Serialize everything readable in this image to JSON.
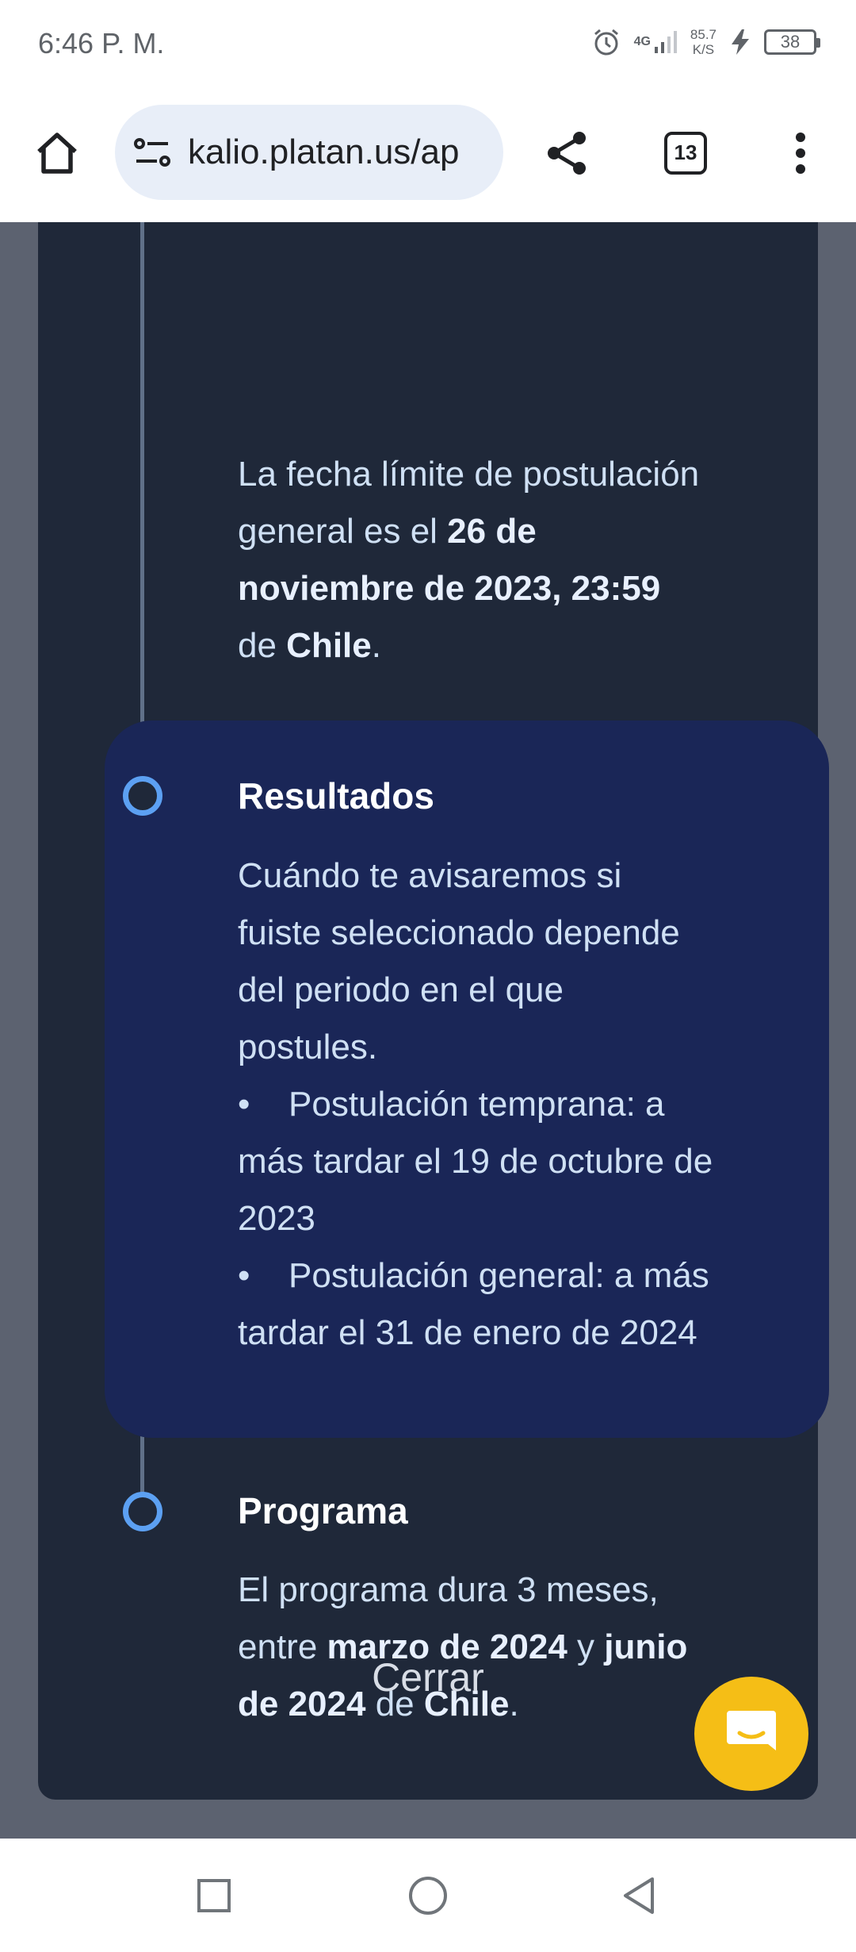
{
  "status_bar": {
    "time": "6:46 P. M.",
    "network_type": "4G",
    "network_speed_value": "85.7",
    "network_speed_unit": "K/S",
    "battery_level": "38",
    "icons": [
      "alarm-icon",
      "signal-icon",
      "charging-icon",
      "battery-icon"
    ]
  },
  "browser": {
    "url": "kalio.platan.us/ap",
    "tab_count": "13",
    "icons": [
      "home-icon",
      "site-info-icon",
      "share-icon",
      "tab-switcher-icon",
      "more-vert-icon"
    ]
  },
  "timeline": {
    "deadline_text": {
      "line1": "La fecha límite de postulación",
      "line2_pre": "general es el ",
      "line2_bold": "26 de",
      "line3_bold": "noviembre de 2023, 23:59",
      "line4_pre": "de ",
      "line4_bold": "Chile",
      "line4_post": "."
    },
    "results": {
      "title": "Resultados",
      "body": [
        "Cuándo te avisaremos si",
        "fuiste seleccionado depende",
        "del periodo en el que",
        "postules."
      ],
      "bullet": "•",
      "early": [
        "Postulación temprana: a",
        "más tardar el 19 de octubre de",
        "2023"
      ],
      "general": [
        "Postulación general: a más",
        "tardar el 31 de enero de 2024"
      ]
    },
    "program": {
      "title": "Programa",
      "line1": "El programa dura 3 meses,",
      "line2_pre": "entre ",
      "line2_bold1": "marzo de 2024",
      "line2_mid": " y ",
      "line2_bold2": "junio",
      "line3_bold1": "de 2024",
      "line3_mid": " de ",
      "line3_bold2": "Chile",
      "line3_post": "."
    }
  },
  "modal": {
    "close_label": "Cerrar"
  },
  "colors": {
    "accent": "#5ca0f2",
    "chat_button": "#f5be16",
    "modal_bg": "#1f2839",
    "highlight_card": "#1a2657"
  },
  "nav_bar": {
    "icons": [
      "recents-icon",
      "home-circle-icon",
      "back-icon"
    ]
  }
}
